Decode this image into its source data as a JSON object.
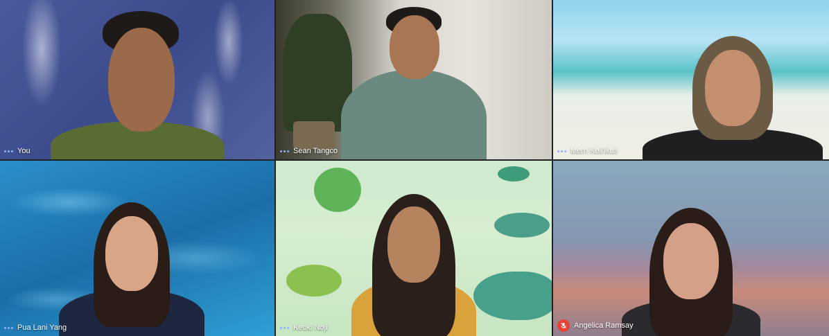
{
  "participants": [
    {
      "name": "You",
      "muted": false
    },
    {
      "name": "Sean Tangco",
      "muted": false
    },
    {
      "name": "Merri Keli'ikuli",
      "muted": false
    },
    {
      "name": "Pua Lani Yang",
      "muted": false
    },
    {
      "name": "Keoki Noji",
      "muted": false
    },
    {
      "name": "Angelica Ramsay",
      "muted": true
    }
  ],
  "icons": {
    "speaking": "three-dots-icon",
    "muted": "mic-off-icon"
  },
  "colors": {
    "tile_gap": "#202124",
    "speaking_dots": "#8ab4f8",
    "muted_badge": "#ea4335",
    "label_text": "#ffffff"
  }
}
